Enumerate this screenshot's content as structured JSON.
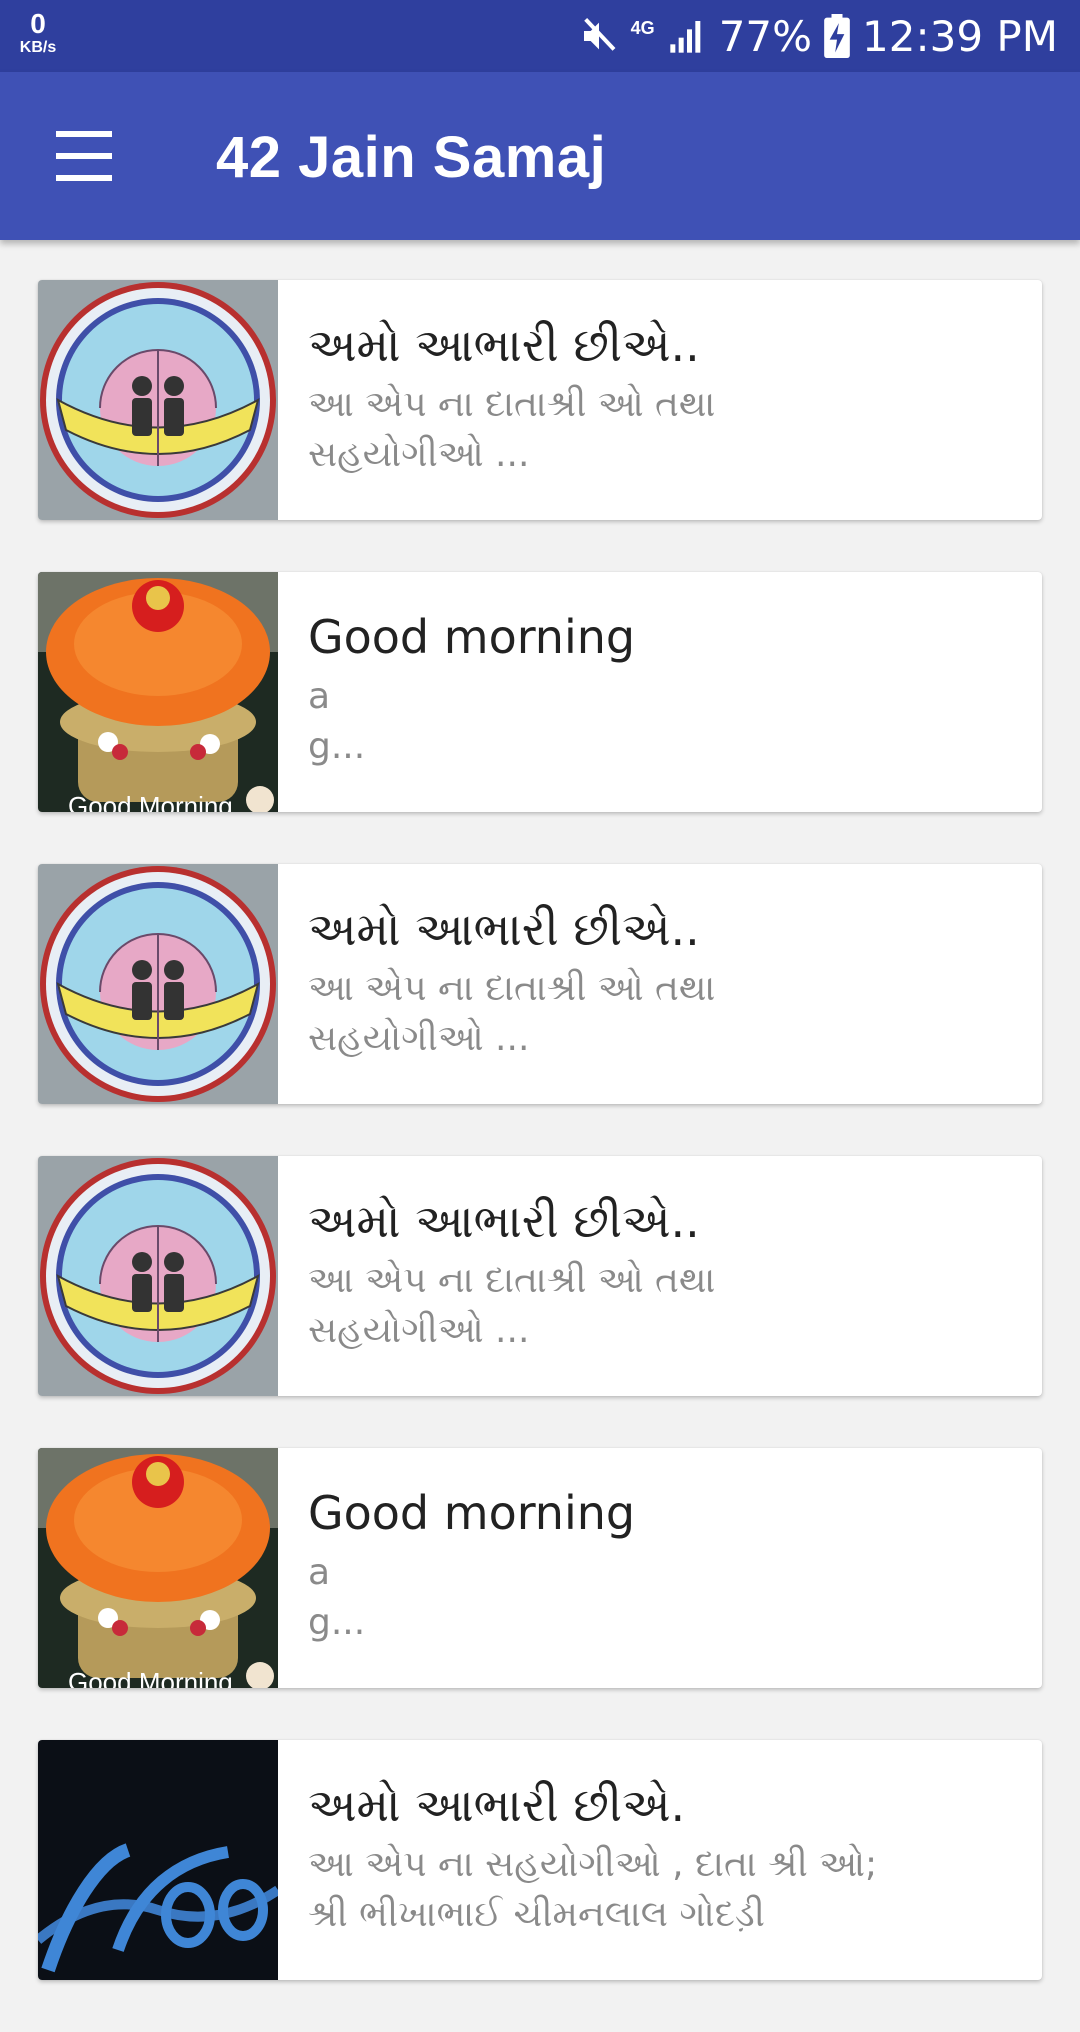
{
  "status_bar": {
    "network_speed_value": "0",
    "network_speed_unit": "KB/s",
    "network_type": "4G",
    "battery": "77%",
    "time": "12:39 PM",
    "icons": [
      "mute-icon",
      "signal-icon",
      "battery-charging-icon"
    ]
  },
  "app_bar": {
    "title": "42 Jain Samaj",
    "menu_icon": "hamburger-menu-icon"
  },
  "feed": {
    "items": [
      {
        "thumbnail": "logo",
        "title": "અમો આભારી છીએ..",
        "description": "આ એપ ના દાતાશ્રી ઓ તથા\nસહયોગીઓ ..."
      },
      {
        "thumbnail": "flowers",
        "thumbnail_caption": "Good Morning",
        "title": "Good morning",
        "description": "a\ng..."
      },
      {
        "thumbnail": "logo",
        "title": "અમો આભારી છીએ..",
        "description": "આ એપ ના દાતાશ્રી ઓ તથા\nસહયોગીઓ ..."
      },
      {
        "thumbnail": "logo",
        "title": "અમો આભારી છીએ..",
        "description": "આ એપ ના દાતાશ્રી ઓ તથા\nસહયોગીઓ ..."
      },
      {
        "thumbnail": "flowers",
        "thumbnail_caption": "Good Morning",
        "title": "Good morning",
        "description": "a\ng..."
      },
      {
        "thumbnail": "welcome",
        "title": "અમો આભારી છીએ.",
        "description": "આ એપ ના સહયોગીઓ , દાતા શ્રી ઓ;\nશ્રી ભીખાભાઈ ચીમનલાલ ગોદડ઼ી"
      }
    ]
  },
  "colors": {
    "status_bar": "#2f3f9e",
    "app_bar": "#3f51b5",
    "background": "#f2f2f2"
  }
}
